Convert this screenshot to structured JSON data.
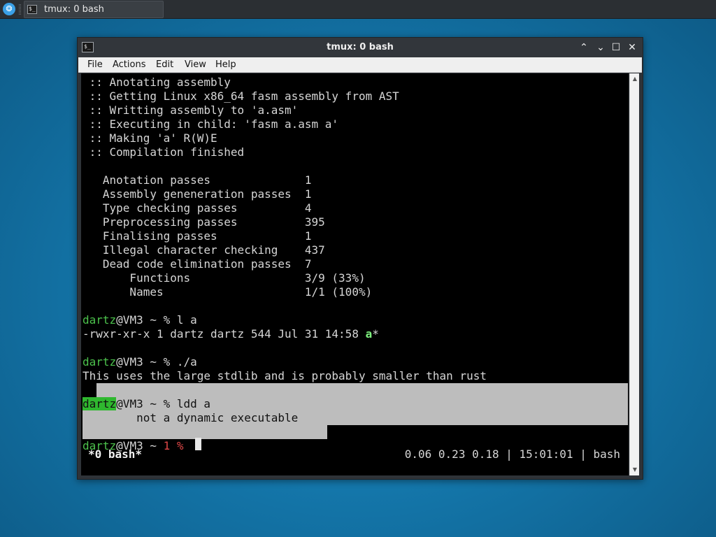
{
  "panel": {
    "task_title": "tmux: 0 bash",
    "launcher_glyph": "❂",
    "task_icon_glyph": "$_"
  },
  "window": {
    "title": "tmux: 0 bash",
    "title_icon_glyph": "$_",
    "buttons": {
      "minimize": "⌃",
      "minimize2": "⌄",
      "maximize": "☐",
      "close": "✕"
    }
  },
  "menu": [
    "File",
    "Actions",
    "Edit",
    "View",
    "Help"
  ],
  "terminal": {
    "lines": [
      " :: Anotating assembly",
      " :: Getting Linux x86_64 fasm assembly from AST",
      " :: Writting assembly to 'a.asm'",
      " :: Executing in child: 'fasm a.asm a'",
      " :: Making 'a' R(W)E",
      " :: Compilation finished",
      "",
      "   Anotation passes              1",
      "   Assembly geneneration passes  1",
      "   Type checking passes          4",
      "   Preprocessing passes          395",
      "   Finalising passes             1",
      "   Illegal character checking    437",
      "   Dead code elimination passes  7",
      "       Functions                 3/9 (33%)",
      "       Names                     1/1 (100%)"
    ],
    "prompt1": {
      "user": "dartz",
      "host": "@VM3 ~ % ",
      "cmd": "l a"
    },
    "ls_line": {
      "prefix": "-rwxr-xr-x 1 dartz dartz 544 Jul 31 14:58 ",
      "name": "a",
      "suffix": "*"
    },
    "prompt2": {
      "user": "dartz",
      "host": "@VM3 ~ % ",
      "cmd": "./a"
    },
    "output_a": "This uses the large stdlib and is probably smaller than rust",
    "prompt3": {
      "user": "dartz",
      "host": "@VM3 ~ % ",
      "cmd": "ldd a"
    },
    "ldd_out": "        not a dynamic executable",
    "prompt4": {
      "user": "dartz",
      "host": "@VM3 ~ ",
      "code": "1",
      "sym": " %"
    },
    "status_left": "*0 bash*",
    "status_right": "0.06 0.23 0.18 | 15:01:01 | bash"
  },
  "scrollbar": {
    "up": "▲",
    "down": "▼"
  }
}
